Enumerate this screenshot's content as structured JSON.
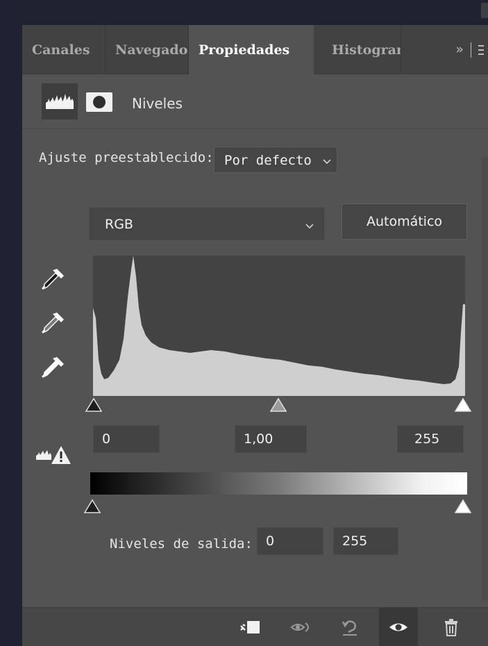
{
  "tabs": [
    {
      "label": "Canales",
      "active": false
    },
    {
      "label": "Navegador",
      "active": false
    },
    {
      "label": "Propiedades",
      "active": true
    },
    {
      "label": "Histograma",
      "active": false
    }
  ],
  "tab_overflow_glyph": "»",
  "header": {
    "title": "Niveles",
    "icons": [
      "levels-histogram-icon",
      "layer-mask-icon"
    ]
  },
  "preset": {
    "label": "Ajuste preestablecido:",
    "value": "Por defecto"
  },
  "channel": {
    "value": "RGB"
  },
  "auto_button": {
    "label": "Automático"
  },
  "input_levels": {
    "shadows": "0",
    "midtones": "1,00",
    "highlights": "255"
  },
  "output_levels": {
    "label": "Niveles de salida:",
    "min": "0",
    "max": "255"
  },
  "icons": [
    "eyedropper-black-icon",
    "eyedropper-gray-icon",
    "eyedropper-white-icon",
    "clipping-warning-icon",
    "clip-to-layer-icon",
    "view-previous-icon",
    "reset-icon",
    "visibility-eye-icon",
    "trash-icon",
    "chevron-down-icon",
    "panel-menu-icon"
  ],
  "colors": {
    "panel_bg": "#535353",
    "tab_bar_bg": "#424242",
    "field_bg": "#434343",
    "histogram_fill": "#cfcfcf",
    "app_bg": "#1e2233"
  }
}
